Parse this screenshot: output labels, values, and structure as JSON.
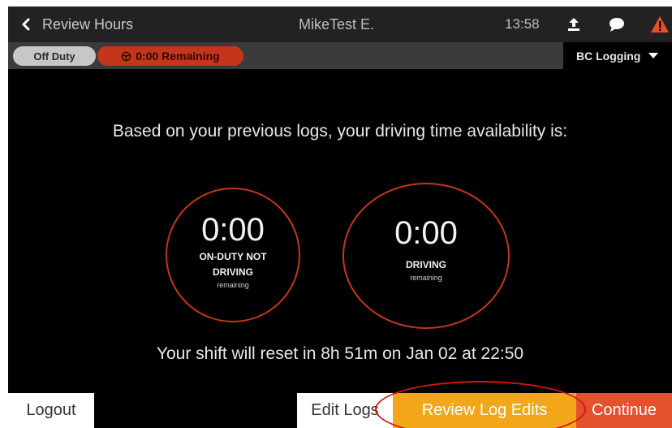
{
  "header": {
    "back_label": "Review Hours",
    "driver_name": "MikeTest E.",
    "time": "13:58",
    "icons": [
      "chevron-left-icon",
      "upload-icon",
      "chat-bubble-icon",
      "warning-icon"
    ]
  },
  "status_bar": {
    "duty_status": "Off Duty",
    "remaining": "0:00 Remaining",
    "ruleset": "BC Logging",
    "colors": {
      "remaining_bg": "#c4361c",
      "duty_bg": "#c7c7c7"
    }
  },
  "availability": {
    "headline": "Based on your previous logs, your driving time availability is:",
    "on_duty": {
      "time": "0:00",
      "label": "ON-DUTY NOT DRIVING",
      "sub": "remaining"
    },
    "driving": {
      "time": "0:00",
      "label": "DRIVING",
      "sub": "remaining"
    },
    "reset_message": "Your shift will reset in 8h 51m on Jan 02 at 22:50"
  },
  "footer": {
    "logout": "Logout",
    "edit_logs": "Edit Logs",
    "review_log_edits": "Review Log Edits",
    "continue": "Continue",
    "colors": {
      "review": "#f2a71b",
      "continue": "#e5512d"
    }
  }
}
